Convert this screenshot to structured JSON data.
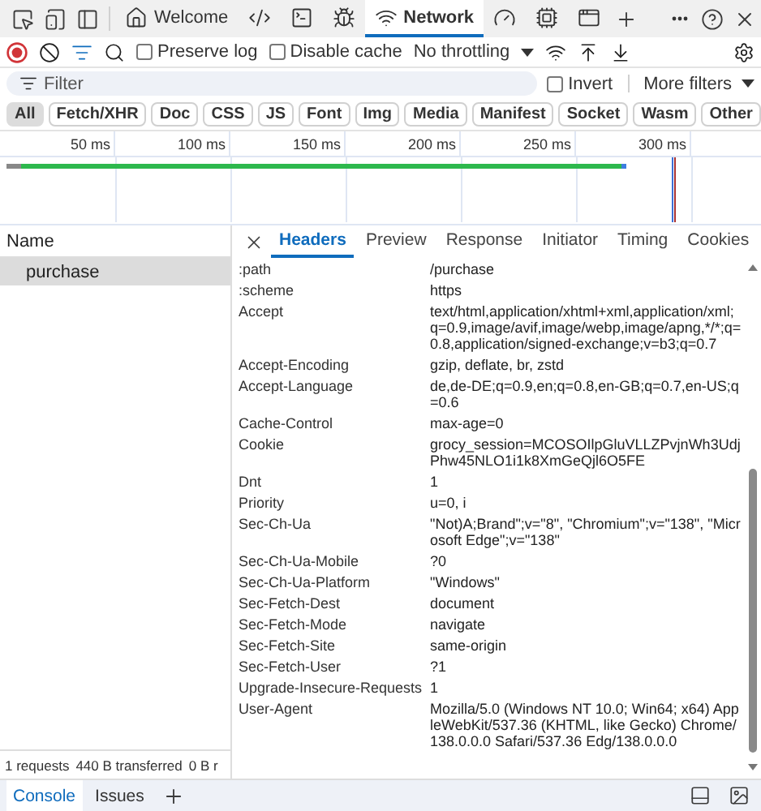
{
  "devtools_tabs": [
    {
      "label": "Welcome",
      "selected": false
    },
    {
      "selected": false
    },
    {
      "selected": false
    },
    {
      "selected": false
    },
    {
      "label": "Network",
      "selected": true
    },
    {
      "selected": false
    },
    {
      "selected": false
    },
    {
      "selected": false
    }
  ],
  "toolbar": {
    "preserve_log": {
      "label": "Preserve log",
      "checked": false
    },
    "disable_cache": {
      "label": "Disable cache",
      "checked": false
    },
    "throttling": "No throttling"
  },
  "filter": {
    "placeholder": "Filter",
    "invert": {
      "label": "Invert",
      "checked": false
    },
    "more_filters": "More filters"
  },
  "type_filters": [
    {
      "label": "All",
      "selected": true
    },
    {
      "label": "Fetch/XHR",
      "selected": false
    },
    {
      "label": "Doc",
      "selected": false
    },
    {
      "label": "CSS",
      "selected": false
    },
    {
      "label": "JS",
      "selected": false
    },
    {
      "label": "Font",
      "selected": false
    },
    {
      "label": "Img",
      "selected": false
    },
    {
      "label": "Media",
      "selected": false
    },
    {
      "label": "Manifest",
      "selected": false
    },
    {
      "label": "Socket",
      "selected": false
    },
    {
      "label": "Wasm",
      "selected": false
    },
    {
      "label": "Other",
      "selected": false
    }
  ],
  "timeline": {
    "ticks": [
      "50 ms",
      "100 ms",
      "150 ms",
      "200 ms",
      "250 ms",
      "300 ms"
    ]
  },
  "requests": {
    "column": "Name",
    "rows": [
      {
        "name": "purchase",
        "selected": true
      }
    ]
  },
  "status_bar": [
    "1 requests",
    "440 B transferred",
    "0 B r"
  ],
  "details": {
    "tabs": [
      {
        "label": "Headers",
        "selected": true
      },
      {
        "label": "Preview",
        "selected": false
      },
      {
        "label": "Response",
        "selected": false
      },
      {
        "label": "Initiator",
        "selected": false
      },
      {
        "label": "Timing",
        "selected": false
      },
      {
        "label": "Cookies",
        "selected": false
      }
    ],
    "headers": [
      {
        "name": ":path",
        "value": "/purchase"
      },
      {
        "name": ":scheme",
        "value": "https"
      },
      {
        "name": "Accept",
        "value": "text/html,application/xhtml+xml,application/xml;q=0.9,image/avif,image/webp,image/apng,*/*;q=0.8,application/signed-exchange;v=b3;q=0.7"
      },
      {
        "name": "Accept-Encoding",
        "value": "gzip, deflate, br, zstd"
      },
      {
        "name": "Accept-Language",
        "value": "de,de-DE;q=0.9,en;q=0.8,en-GB;q=0.7,en-US;q=0.6"
      },
      {
        "name": "Cache-Control",
        "value": "max-age=0"
      },
      {
        "name": "Cookie",
        "value": "grocy_session=MCOSOIlpGluVLLZPvjnWh3UdjPhw45NLO1i1k8XmGeQjl6O5FE"
      },
      {
        "name": "Dnt",
        "value": "1"
      },
      {
        "name": "Priority",
        "value": "u=0, i"
      },
      {
        "name": "Sec-Ch-Ua",
        "value": "\"Not)A;Brand\";v=\"8\", \"Chromium\";v=\"138\", \"Microsoft Edge\";v=\"138\""
      },
      {
        "name": "Sec-Ch-Ua-Mobile",
        "value": "?0"
      },
      {
        "name": "Sec-Ch-Ua-Platform",
        "value": "\"Windows\""
      },
      {
        "name": "Sec-Fetch-Dest",
        "value": "document"
      },
      {
        "name": "Sec-Fetch-Mode",
        "value": "navigate"
      },
      {
        "name": "Sec-Fetch-Site",
        "value": "same-origin"
      },
      {
        "name": "Sec-Fetch-User",
        "value": "?1"
      },
      {
        "name": "Upgrade-Insecure-Requests",
        "value": "1"
      },
      {
        "name": "User-Agent",
        "value": "Mozilla/5.0 (Windows NT 10.0; Win64; x64) AppleWebKit/537.36 (KHTML, like Gecko) Chrome/138.0.0.0 Safari/537.36 Edg/138.0.0.0"
      }
    ]
  },
  "drawer": {
    "tabs": [
      {
        "label": "Console",
        "selected": true
      },
      {
        "label": "Issues",
        "selected": false
      }
    ]
  }
}
